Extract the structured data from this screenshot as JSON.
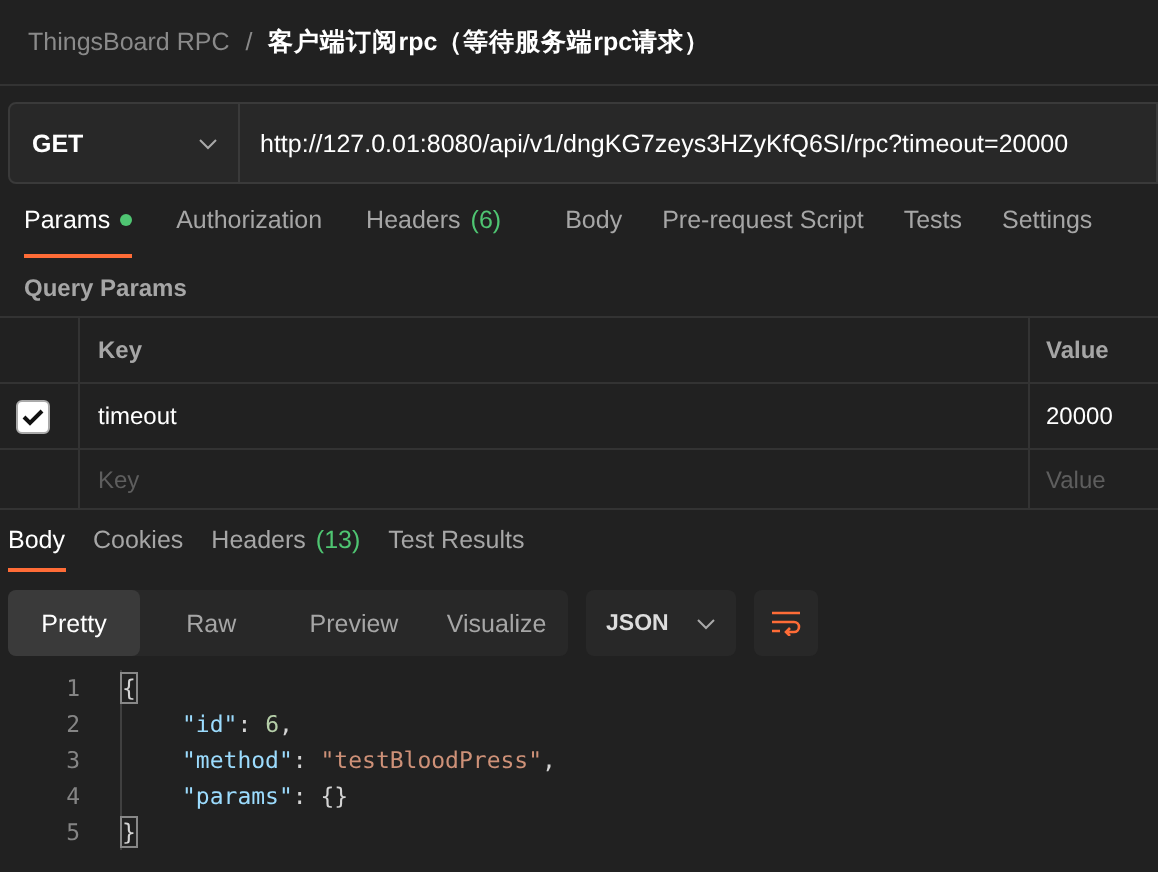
{
  "breadcrumb": {
    "collection": "ThingsBoard RPC",
    "separator": "/",
    "request": "客户端订阅rpc（等待服务端rpc请求）"
  },
  "request": {
    "method": "GET",
    "url": "http://127.0.01:8080/api/v1/dngKG7zeys3HZyKfQ6SI/rpc?timeout=20000"
  },
  "request_tabs": [
    {
      "label": "Params",
      "dot": true,
      "selected": true
    },
    {
      "label": "Authorization",
      "dot": false,
      "selected": false
    },
    {
      "label": "Headers",
      "count": "(6)",
      "dot": false,
      "selected": false
    },
    {
      "label": "Body",
      "dot": false,
      "selected": false
    },
    {
      "label": "Pre-request Script",
      "dot": false,
      "selected": false
    },
    {
      "label": "Tests",
      "dot": false,
      "selected": false
    },
    {
      "label": "Settings",
      "dot": false,
      "selected": false
    }
  ],
  "query_params": {
    "title": "Query Params",
    "columns": [
      "Key",
      "Value"
    ],
    "rows": [
      {
        "checked": true,
        "key": "timeout",
        "value": "20000"
      }
    ],
    "new_row": {
      "key_placeholder": "Key",
      "value_placeholder": "Value"
    }
  },
  "response_tabs": [
    {
      "label": "Body",
      "selected": true
    },
    {
      "label": "Cookies",
      "selected": false
    },
    {
      "label": "Headers",
      "count": "(13)",
      "selected": false
    },
    {
      "label": "Test Results",
      "selected": false
    }
  ],
  "view_modes": [
    {
      "label": "Pretty",
      "selected": true
    },
    {
      "label": "Raw",
      "selected": false
    },
    {
      "label": "Preview",
      "selected": false
    },
    {
      "label": "Visualize",
      "selected": false
    }
  ],
  "format": "JSON",
  "code_lines": [
    {
      "number": "1",
      "indent": false,
      "tokens": [
        {
          "kind": "bracket",
          "text": "{"
        }
      ]
    },
    {
      "number": "2",
      "indent": true,
      "tokens": [
        {
          "kind": "key",
          "text": "\"id\""
        },
        {
          "kind": "punct",
          "text": ": "
        },
        {
          "kind": "number",
          "text": "6"
        },
        {
          "kind": "punct",
          "text": ","
        }
      ]
    },
    {
      "number": "3",
      "indent": true,
      "tokens": [
        {
          "kind": "key",
          "text": "\"method\""
        },
        {
          "kind": "punct",
          "text": ": "
        },
        {
          "kind": "string",
          "text": "\"testBloodPress\""
        },
        {
          "kind": "punct",
          "text": ","
        }
      ]
    },
    {
      "number": "4",
      "indent": true,
      "tokens": [
        {
          "kind": "key",
          "text": "\"params\""
        },
        {
          "kind": "punct",
          "text": ": "
        },
        {
          "kind": "punct",
          "text": "{}"
        }
      ]
    },
    {
      "number": "5",
      "indent": false,
      "tokens": [
        {
          "kind": "bracket",
          "text": "}"
        }
      ]
    }
  ]
}
